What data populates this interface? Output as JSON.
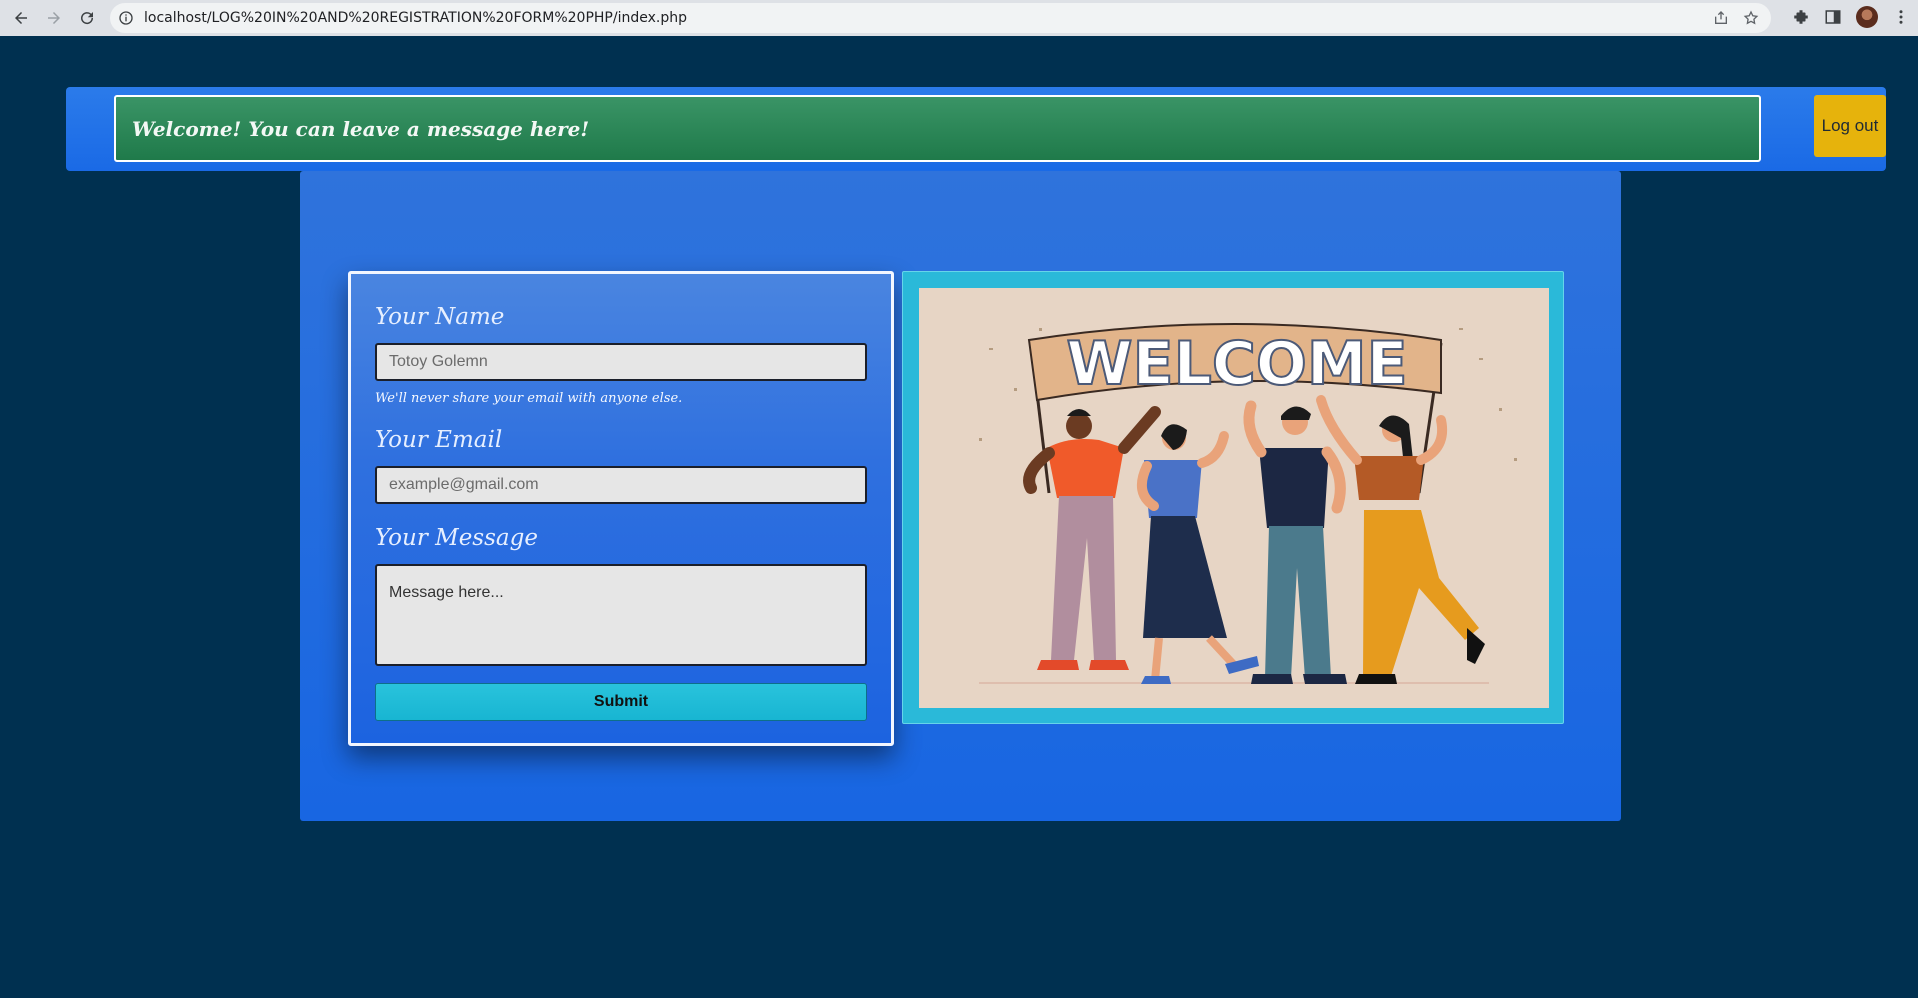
{
  "browser": {
    "url": "localhost/LOG%20IN%20AND%20REGISTRATION%20FORM%20PHP/index.php"
  },
  "header": {
    "welcome_message": "Welcome! You can leave a message here!",
    "logout_label": "Log out"
  },
  "form": {
    "name_label": "Your Name",
    "name_placeholder": "Totoy Golemn",
    "hint": "We'll never share your email with anyone else.",
    "email_label": "Your Email",
    "email_placeholder": "example@gmail.com",
    "message_label": "Your Message",
    "message_placeholder": "Message here...",
    "submit_label": "Submit"
  },
  "illustration": {
    "banner_text": "WELCOME"
  },
  "colors": {
    "page_bg": "#003050",
    "panel_bg": "#1866e2",
    "alert_bg": "#1f7a4a",
    "logout_bg": "#e6b30c",
    "submit_bg": "#18b5d2",
    "image_frame": "#2ab9d9"
  }
}
